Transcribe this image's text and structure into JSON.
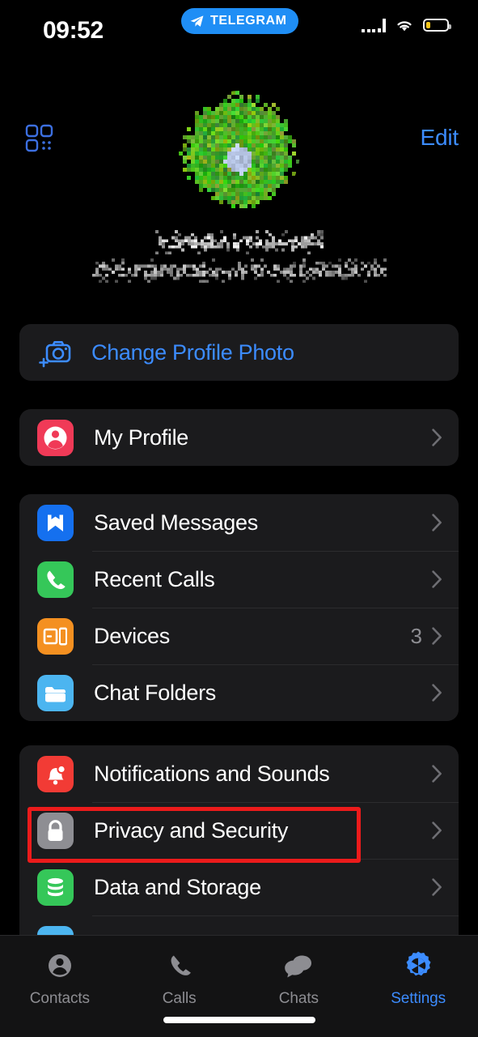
{
  "status_bar": {
    "time": "09:52",
    "app_pill_label": "TELEGRAM",
    "app_pill_icon": "paper-plane-icon",
    "cellular_icon": "cellular-signal-icon",
    "wifi_icon": "wifi-icon",
    "battery_icon": "battery-low-icon",
    "battery_level_pct": 22,
    "pill_color": "#1f8ef5",
    "battery_color": "#f5c518"
  },
  "nav_bar": {
    "qr_icon": "qr-code-icon",
    "edit_label": "Edit",
    "accent_color": "#3c8cff"
  },
  "profile": {
    "avatar_icon": "profile-avatar-pixelated",
    "name": "",
    "name_state": "redacted-pixelated",
    "subtitle": "",
    "subtitle_state": "redacted-pixelated"
  },
  "groups": [
    {
      "name": "change-photo-group",
      "rows": [
        {
          "key": "change-profile-photo",
          "label": "Change Profile Photo",
          "icon": "camera-plus-icon",
          "icon_color": "#3c8cff",
          "style": "action",
          "value": "",
          "chevron": false
        }
      ]
    },
    {
      "name": "profile-group",
      "rows": [
        {
          "key": "my-profile",
          "label": "My Profile",
          "icon": "person-circle-icon",
          "icon_color": "#f03a57",
          "style": "normal",
          "value": "",
          "chevron": true
        }
      ]
    },
    {
      "name": "main-group",
      "rows": [
        {
          "key": "saved-messages",
          "label": "Saved Messages",
          "icon": "bookmark-icon",
          "icon_color": "#1570ef",
          "style": "normal",
          "value": "",
          "chevron": true
        },
        {
          "key": "recent-calls",
          "label": "Recent Calls",
          "icon": "phone-icon",
          "icon_color": "#35c759",
          "style": "normal",
          "value": "",
          "chevron": true
        },
        {
          "key": "devices",
          "label": "Devices",
          "icon": "devices-icon",
          "icon_color": "#f49021",
          "style": "normal",
          "value": "3",
          "chevron": true
        },
        {
          "key": "chat-folders",
          "label": "Chat Folders",
          "icon": "folder-icon",
          "icon_color": "#4cb5f0",
          "style": "normal",
          "value": "",
          "chevron": true
        }
      ]
    },
    {
      "name": "settings-group",
      "rows": [
        {
          "key": "notifications-and-sounds",
          "label": "Notifications and Sounds",
          "icon": "bell-icon",
          "icon_color": "#f23b35",
          "style": "normal",
          "value": "",
          "chevron": true
        },
        {
          "key": "privacy-and-security",
          "label": "Privacy and Security",
          "icon": "lock-icon",
          "icon_color": "#8e8e93",
          "style": "normal",
          "value": "",
          "chevron": true,
          "highlighted": true
        },
        {
          "key": "data-and-storage",
          "label": "Data and Storage",
          "icon": "database-icon",
          "icon_color": "#35c759",
          "style": "normal",
          "value": "",
          "chevron": true
        }
      ]
    }
  ],
  "highlight": {
    "target": "privacy-and-security",
    "color": "#ec1b1b"
  },
  "tab_bar": {
    "active": "settings",
    "active_color": "#3c8cff",
    "inactive_color": "#8d8d92",
    "items": [
      {
        "key": "contacts",
        "label": "Contacts",
        "icon": "person-icon"
      },
      {
        "key": "calls",
        "label": "Calls",
        "icon": "phone-icon"
      },
      {
        "key": "chats",
        "label": "Chats",
        "icon": "chat-bubbles-icon"
      },
      {
        "key": "settings",
        "label": "Settings",
        "icon": "gear-icon"
      }
    ]
  }
}
